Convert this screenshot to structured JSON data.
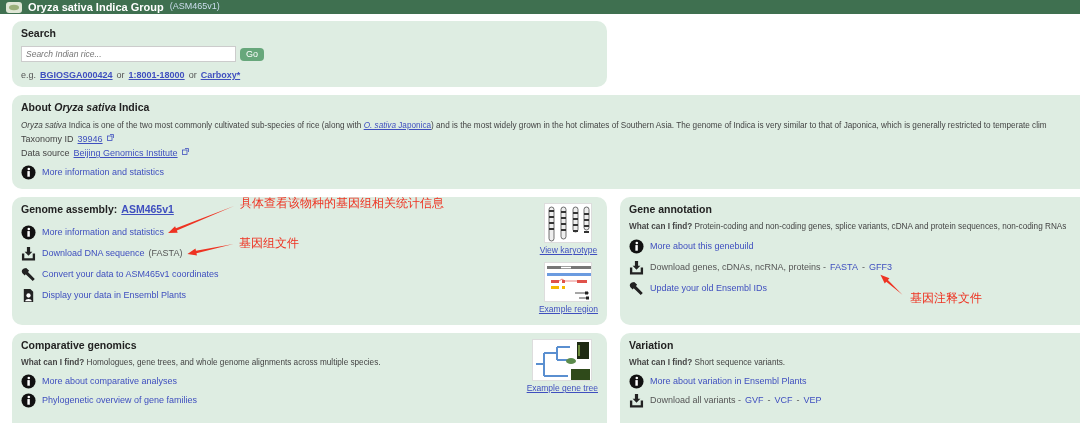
{
  "header": {
    "title": "Oryza sativa Indica Group",
    "assembly": "(ASM465v1)"
  },
  "search": {
    "title": "Search",
    "placeholder": "Search Indian rice...",
    "button": "Go",
    "examples": [
      {
        "kind": "text",
        "text": "e.g."
      },
      {
        "kind": "link",
        "text": "BGIOSGA000424"
      },
      {
        "kind": "text",
        "text": "or"
      },
      {
        "kind": "link",
        "text": "1:8001-18000"
      },
      {
        "kind": "text",
        "text": "or"
      },
      {
        "kind": "link",
        "text": "Carboxy*"
      }
    ]
  },
  "about": {
    "title": "About *Oryza sativa* Indica",
    "description_before": "*Oryza sativa* Indica is one of the two most commonly cultivated sub-species of rice (along with ",
    "description_link": "*O. sativa* Japonica",
    "description_after": ") and is the most widely grown in the hot climates of Southern Asia. The genome of Indica is very similar to that of Japonica, which is generally restricted to temperate clim",
    "facts": [
      {
        "label": "Taxonomy ID",
        "value": "39946"
      },
      {
        "label": "Data source",
        "value": "Beijing Genomics Institute"
      }
    ],
    "links": [
      {
        "kind": "info",
        "parts": [
          {
            "kind": "link",
            "text": "More information and statistics"
          }
        ]
      }
    ]
  },
  "sections": [
    {
      "title": "Genome assembly:",
      "title_link": "ASM465v1",
      "links": [
        {
          "kind": "info",
          "parts": [
            {
              "kind": "link",
              "text": "More information and statistics"
            }
          ]
        },
        {
          "kind": "download",
          "parts": [
            {
              "kind": "link",
              "text": "Download DNA sequence"
            },
            {
              "kind": "text",
              "text": "(FASTA)"
            }
          ]
        },
        {
          "kind": "wrench",
          "parts": [
            {
              "kind": "link",
              "text": "Convert your data to ASM465v1 coordinates"
            }
          ]
        },
        {
          "kind": "userdata",
          "parts": [
            {
              "kind": "link",
              "text": "Display your data in Ensembl Plants"
            }
          ]
        }
      ],
      "images": [
        {
          "kind": "karyotype",
          "caption": "View karyotype"
        },
        {
          "kind": "region",
          "caption": "Example region"
        }
      ]
    },
    {
      "title": "Gene annotation",
      "find": "**What can I find?** Protein-coding and non-coding genes, splice variants, cDNA and protein sequences, non-coding RNAs",
      "links": [
        {
          "kind": "info",
          "parts": [
            {
              "kind": "link",
              "text": "More about this genebuild"
            }
          ]
        },
        {
          "kind": "download",
          "parts": [
            {
              "kind": "text",
              "text": "Download genes, cDNAs, ncRNA, proteins -"
            },
            {
              "kind": "link",
              "text": "FASTA"
            },
            {
              "kind": "text",
              "text": "-"
            },
            {
              "kind": "link",
              "text": "GFF3"
            }
          ]
        },
        {
          "kind": "wrench",
          "parts": [
            {
              "kind": "link",
              "text": "Update your old Ensembl IDs"
            }
          ]
        }
      ]
    },
    {
      "title": "Comparative genomics",
      "find": "**What can I find?** Homologues, gene trees, and whole genome alignments across multiple species.",
      "links": [
        {
          "kind": "info",
          "parts": [
            {
              "kind": "link",
              "text": "More about comparative analyses"
            }
          ]
        },
        {
          "kind": "info",
          "parts": [
            {
              "kind": "link",
              "text": "Phylogenetic overview of gene families"
            }
          ]
        }
      ],
      "images": [
        {
          "kind": "genetree",
          "caption": "Example gene tree"
        }
      ]
    },
    {
      "title": "Variation",
      "find": "**What can I find?** Short sequence variants.",
      "links": [
        {
          "kind": "info",
          "parts": [
            {
              "kind": "link",
              "text": "More about variation in Ensembl Plants"
            }
          ]
        },
        {
          "kind": "download",
          "parts": [
            {
              "kind": "text",
              "text": "Download all variants -"
            },
            {
              "kind": "link",
              "text": "GVF"
            },
            {
              "kind": "text",
              "text": "-"
            },
            {
              "kind": "link",
              "text": "VCF"
            },
            {
              "kind": "text",
              "text": "-"
            },
            {
              "kind": "link",
              "text": "VEP"
            }
          ]
        }
      ]
    }
  ],
  "annotations": [
    "具体查看该物种的基因组相关统计信息",
    "基因组文件",
    "基因注释文件"
  ]
}
